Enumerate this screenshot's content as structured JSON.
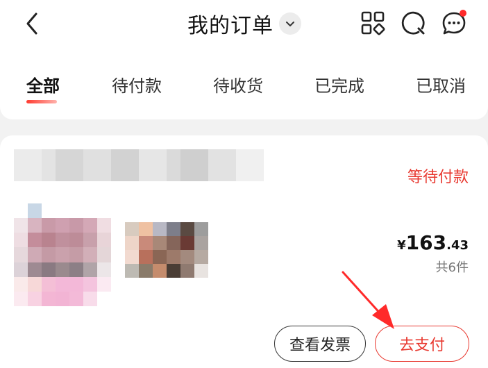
{
  "header": {
    "title": "我的订单",
    "icons": [
      "back-icon",
      "chevron-down-icon",
      "apps-icon",
      "search-icon",
      "message-icon"
    ]
  },
  "tabs": [
    {
      "label": "全部",
      "active": true
    },
    {
      "label": "待付款",
      "active": false
    },
    {
      "label": "待收货",
      "active": false
    },
    {
      "label": "已完成",
      "active": false
    },
    {
      "label": "已取消",
      "active": false
    }
  ],
  "order": {
    "status": "等待付款",
    "price_currency": "¥",
    "price_integer": "163",
    "price_decimal": ".43",
    "item_count": "共6件",
    "invoice_label": "查看发票",
    "pay_label": "去支付"
  },
  "colors": {
    "accent": "#e8382f",
    "background": "#f2f2f2",
    "card": "#ffffff"
  }
}
